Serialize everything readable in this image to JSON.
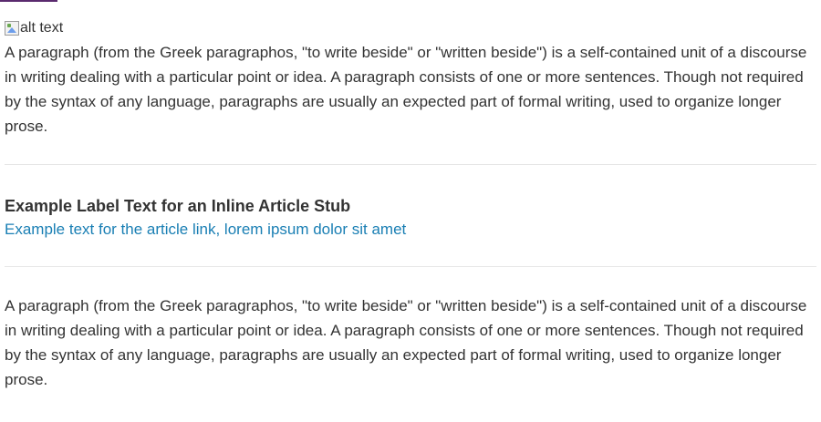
{
  "image": {
    "alt": "alt text"
  },
  "paragraphs": [
    "A paragraph (from the Greek paragraphos, \"to write beside\" or \"written beside\") is a self-contained unit of a discourse in writing dealing with a particular point or idea. A paragraph consists of one or more sentences. Though not required by the syntax of any language, paragraphs are usually an expected part of formal writing, used to organize longer prose.",
    "A paragraph (from the Greek paragraphos, \"to write beside\" or \"written beside\") is a self-contained unit of a discourse in writing dealing with a particular point or idea. A paragraph consists of one or more sentences. Though not required by the syntax of any language, paragraphs are usually an expected part of formal writing, used to organize longer prose."
  ],
  "article_stub": {
    "label": "Example Label Text for an Inline Article Stub",
    "link_text": "Example text for the article link, lorem ipsum dolor sit amet"
  },
  "colors": {
    "text": "#333333",
    "link": "#1a7fb4",
    "divider": "#e6e6e6",
    "accent": "#5a2a6e"
  }
}
